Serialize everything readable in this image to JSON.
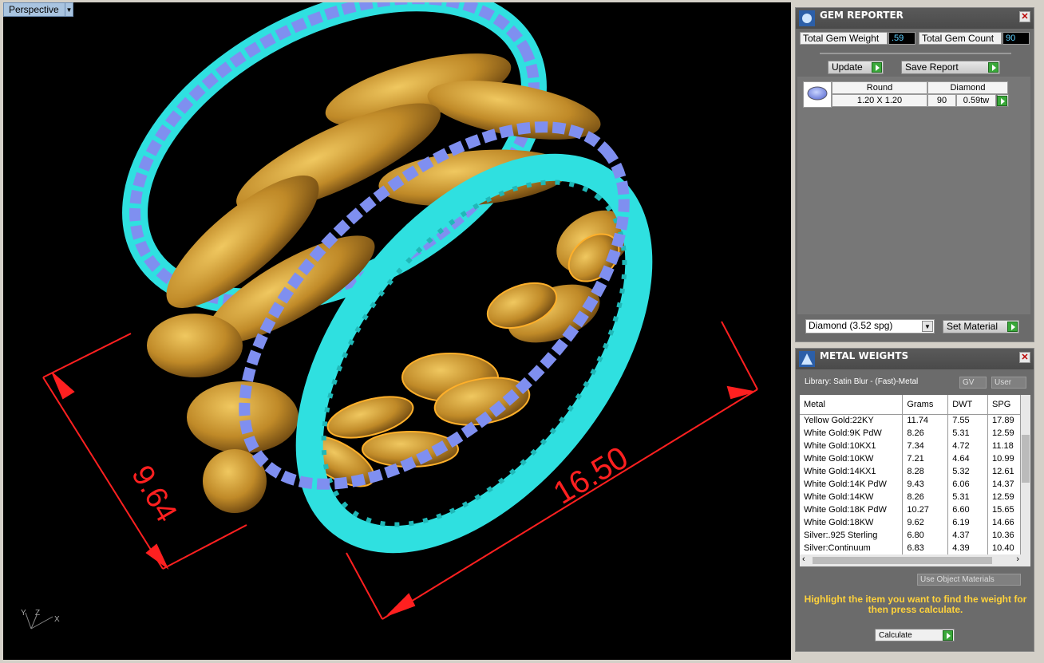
{
  "viewport": {
    "label": "Perspective",
    "dim_width": "16.50",
    "dim_height": "9.64",
    "axes": {
      "y": "Y",
      "z": "Z",
      "x": "X"
    }
  },
  "gem_reporter": {
    "title": "GEM REPORTER",
    "total_weight_label": "Total Gem Weight",
    "total_weight_value": ".59",
    "total_count_label": "Total Gem Count",
    "total_count_value": "90",
    "update_label": "Update",
    "save_report_label": "Save Report",
    "gem_row": {
      "shape": "Round",
      "type": "Diamond",
      "size": "1.20 X 1.20",
      "count": "90",
      "weight": "0.59tw"
    },
    "material_select": "Diamond    (3.52 spg)",
    "set_material_label": "Set Material"
  },
  "metal_weights": {
    "title": "METAL WEIGHTS",
    "library": "Library: Satin Blur - (Fast)-Metal",
    "gv_label": "GV",
    "user_label": "User",
    "columns": [
      "Metal",
      "Grams",
      "DWT",
      "SPG"
    ],
    "rows": [
      [
        "Yellow Gold:22KY",
        "11.74",
        "7.55",
        "17.89"
      ],
      [
        "White Gold:9K PdW",
        "8.26",
        "5.31",
        "12.59"
      ],
      [
        "White Gold:10KX1",
        "7.34",
        "4.72",
        "11.18"
      ],
      [
        "White Gold:10KW",
        "7.21",
        "4.64",
        "10.99"
      ],
      [
        "White Gold:14KX1",
        "8.28",
        "5.32",
        "12.61"
      ],
      [
        "White Gold:14K PdW",
        "9.43",
        "6.06",
        "14.37"
      ],
      [
        "White Gold:14KW",
        "8.26",
        "5.31",
        "12.59"
      ],
      [
        "White Gold:18K PdW",
        "10.27",
        "6.60",
        "15.65"
      ],
      [
        "White Gold:18KW",
        "9.62",
        "6.19",
        "14.66"
      ],
      [
        "Silver:.925 Sterling",
        "6.80",
        "4.37",
        "10.36"
      ],
      [
        "Silver:Continuum",
        "6.83",
        "4.39",
        "10.40"
      ]
    ],
    "use_object_materials": "Use Object Materials",
    "message": "Highlight the item you want to find the weight for then press calculate.",
    "calculate_label": "Calculate"
  },
  "colors": {
    "cyan": "#2fe0e0",
    "gold": "#c89b30",
    "dim": "#ff2020",
    "message": "#ffd23b"
  }
}
